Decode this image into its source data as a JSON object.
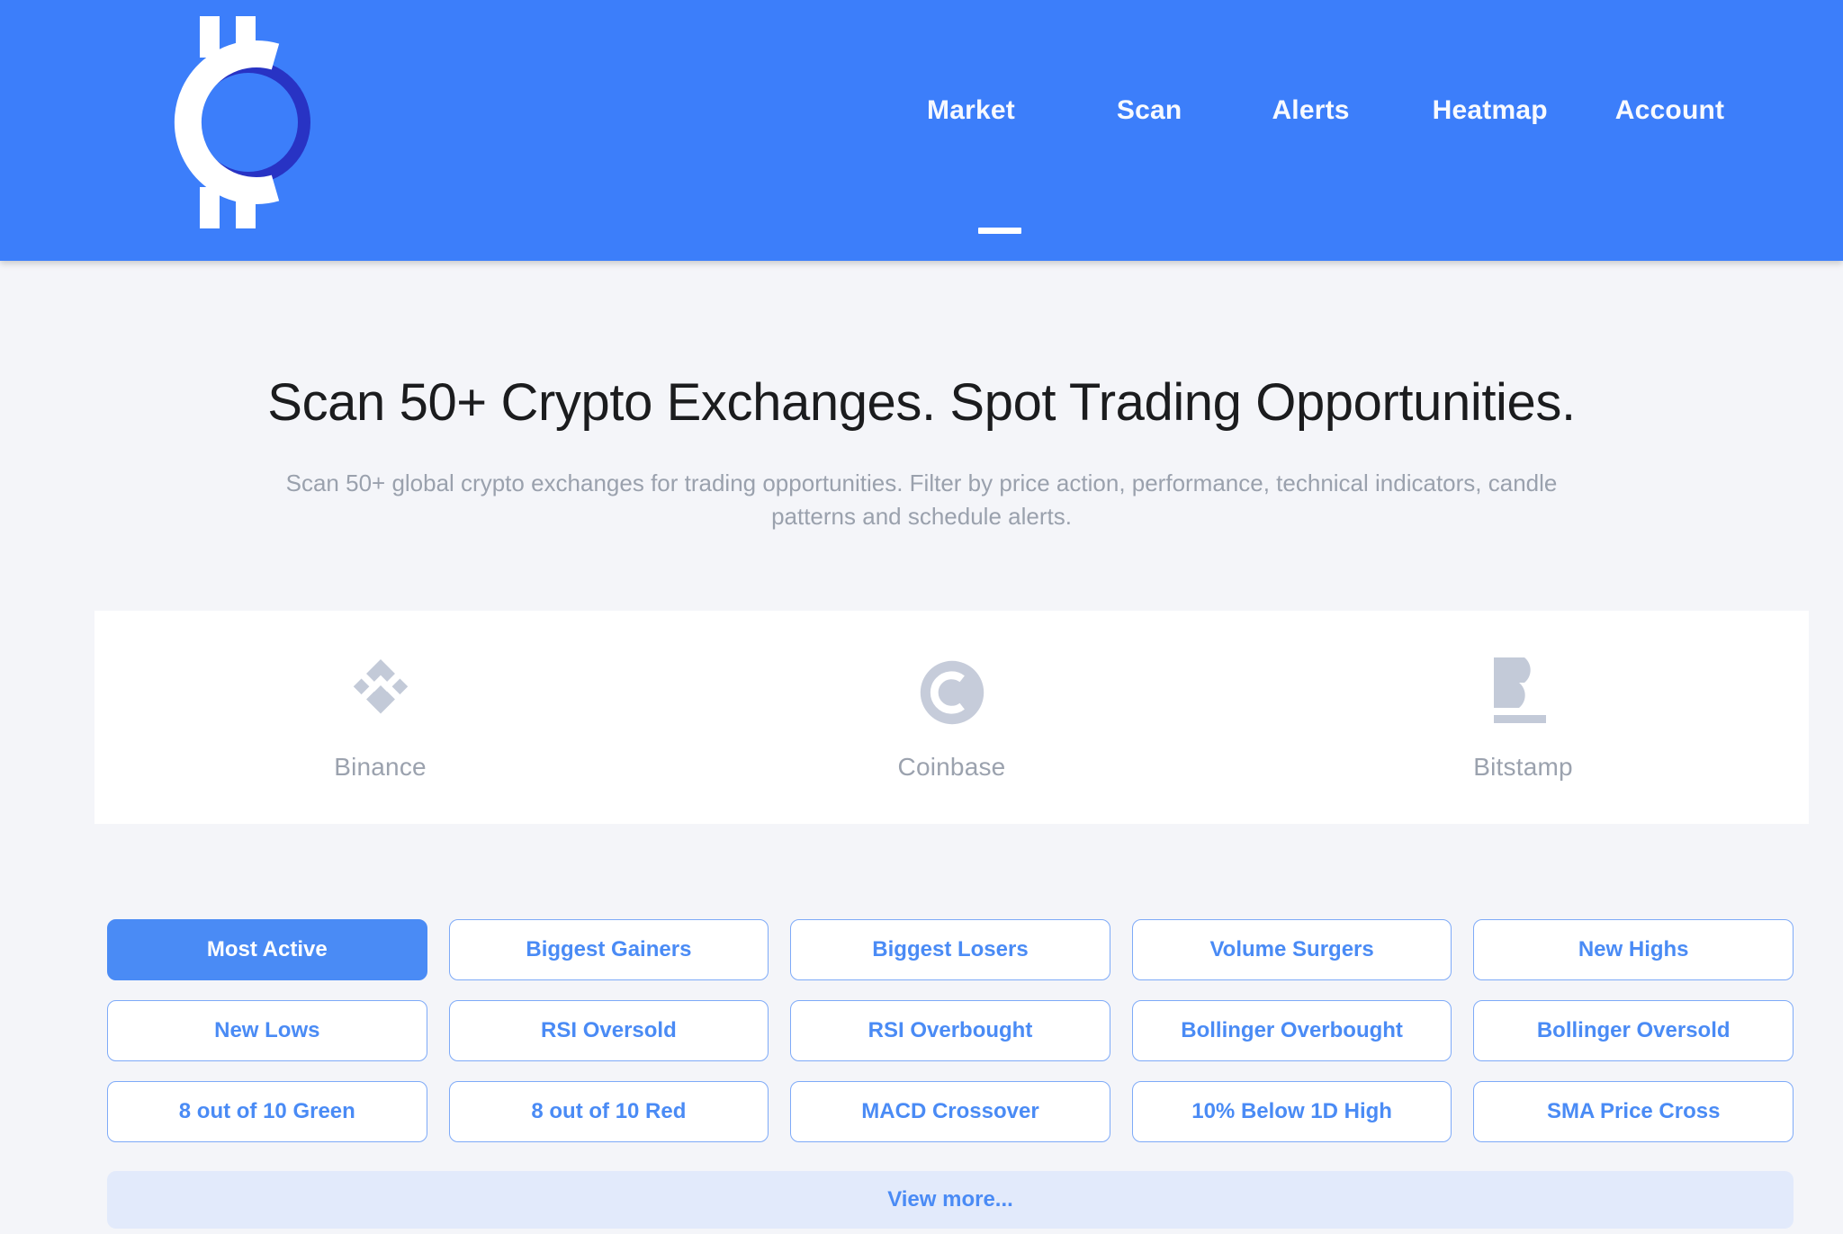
{
  "header": {
    "background_color": "#3c7efa",
    "logo": {
      "icon": "crypto-c-coin-logo",
      "alt": "Crypto scanner logo"
    },
    "nav": {
      "items": [
        {
          "label": "Market",
          "active": true
        },
        {
          "label": "Scan",
          "active": false
        },
        {
          "label": "Alerts",
          "active": false
        },
        {
          "label": "Heatmap",
          "active": false
        },
        {
          "label": "Account",
          "active": false
        }
      ],
      "active_indicator": "underline"
    }
  },
  "hero": {
    "title": "Scan 50+ Crypto Exchanges. Spot Trading Opportunities.",
    "subtitle": "Scan 50+ global crypto exchanges for trading opportunities. Filter by price action, performance, technical indicators, candle patterns and schedule alerts."
  },
  "exchanges": {
    "items": [
      {
        "name": "Binance",
        "icon": "binance-logo-icon"
      },
      {
        "name": "Coinbase",
        "icon": "coinbase-logo-icon"
      },
      {
        "name": "Bitstamp",
        "icon": "bitstamp-logo-icon"
      }
    ]
  },
  "filters": {
    "accent_color": "#4a8bf5",
    "chips": [
      {
        "label": "Most Active",
        "active": true
      },
      {
        "label": "Biggest Gainers",
        "active": false
      },
      {
        "label": "Biggest Losers",
        "active": false
      },
      {
        "label": "Volume Surgers",
        "active": false
      },
      {
        "label": "New Highs",
        "active": false
      },
      {
        "label": "New Lows",
        "active": false
      },
      {
        "label": "RSI Oversold",
        "active": false
      },
      {
        "label": "RSI Overbought",
        "active": false
      },
      {
        "label": "Bollinger Overbought",
        "active": false
      },
      {
        "label": "Bollinger Oversold",
        "active": false
      },
      {
        "label": "8 out of 10 Green",
        "active": false
      },
      {
        "label": "8 out of 10 Red",
        "active": false
      },
      {
        "label": "MACD Crossover",
        "active": false
      },
      {
        "label": "10% Below 1D High",
        "active": false
      },
      {
        "label": "SMA Price Cross",
        "active": false
      }
    ],
    "view_more_label": "View more..."
  }
}
